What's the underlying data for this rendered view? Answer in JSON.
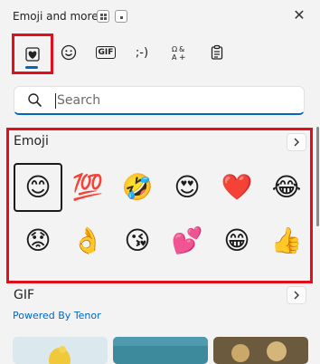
{
  "window": {
    "title": "Emoji and more"
  },
  "close_glyph": "✕",
  "tabs": [
    {
      "name": "recent-heart-tab",
      "icon": "heart-card-icon",
      "active": true
    },
    {
      "name": "emoji-tab",
      "icon": "smiley-icon"
    },
    {
      "name": "gif-tab",
      "icon": "gif-icon",
      "label": "GIF"
    },
    {
      "name": "kaomoji-tab",
      "icon": "kaomoji-icon",
      "label": ";-)"
    },
    {
      "name": "symbols-tab",
      "icon": "symbols-icon"
    },
    {
      "name": "clipboard-tab",
      "icon": "clipboard-icon"
    }
  ],
  "search": {
    "placeholder": "Search"
  },
  "emoji_section": {
    "title": "Emoji",
    "items": [
      {
        "char": "😊",
        "name": "smiling-face",
        "selected": true
      },
      {
        "char": "💯",
        "name": "hundred-points"
      },
      {
        "char": "🤣",
        "name": "rolling-laughing"
      },
      {
        "char": "😍",
        "name": "heart-eyes"
      },
      {
        "char": "❤️",
        "name": "red-heart"
      },
      {
        "char": "😂",
        "name": "tears-of-joy"
      },
      {
        "char": "😟",
        "name": "worried-face"
      },
      {
        "char": "👌",
        "name": "ok-hand"
      },
      {
        "char": "😘",
        "name": "face-blowing-kiss"
      },
      {
        "char": "💕",
        "name": "two-hearts"
      },
      {
        "char": "😁",
        "name": "beaming-face"
      },
      {
        "char": "👍",
        "name": "thumbs-up"
      }
    ]
  },
  "gif_section": {
    "title": "GIF",
    "powered": "Powered By Tenor"
  },
  "colors": {
    "accent": "#0067c0",
    "highlight": "#e10e1c"
  }
}
